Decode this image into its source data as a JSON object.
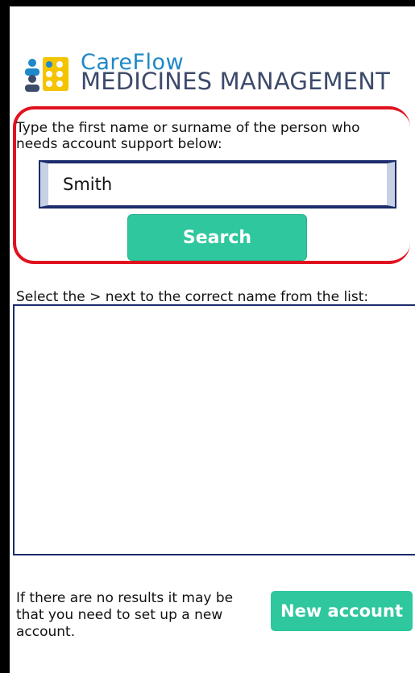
{
  "brand": {
    "name_top": "CareFlow",
    "name_bottom": "MEDICINES MANAGEMENT",
    "colors": {
      "blue": "#1e88c8",
      "yellow": "#f5c400",
      "navy": "#3d4a6a"
    }
  },
  "search": {
    "instruction": "Type the first name or surname of the person who needs account support below:",
    "value": "Smith",
    "button_label": "Search"
  },
  "results": {
    "instruction": "Select the > next to the correct name from the list:",
    "items": []
  },
  "footer": {
    "no_results_text": "If there are no results it may be that you need to set up a new account.",
    "new_account_label": "New account"
  },
  "accent": "#2fc79e",
  "highlight_color": "#e0121f"
}
